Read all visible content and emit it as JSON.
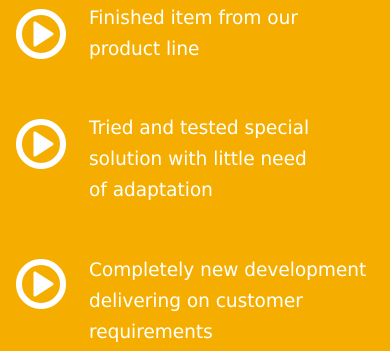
{
  "colors": {
    "background": "#F5AE00",
    "text": "#FFFFFF",
    "icon": "#FFFFFF"
  },
  "items": [
    {
      "icon": "play-circle-icon",
      "lines": [
        "Finished item from our",
        "product line"
      ]
    },
    {
      "icon": "play-circle-icon",
      "lines": [
        "Tried and tested special",
        "solution with little need",
        "of adaptation"
      ]
    },
    {
      "icon": "play-circle-icon",
      "lines": [
        "Completely new development",
        "delivering on customer",
        "requirements"
      ]
    }
  ]
}
